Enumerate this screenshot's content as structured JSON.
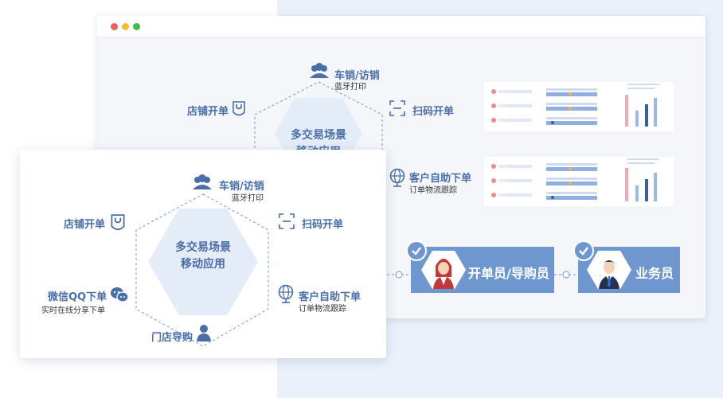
{
  "window": {
    "dot_colors": [
      "#ee5d5a",
      "#f5be2c",
      "#3dbe4f"
    ]
  },
  "back": {
    "top_node": {
      "label": "车销/访销",
      "sub": "蓝牙打印",
      "icon": "people-group-icon"
    },
    "left_node": {
      "label": "店铺开单",
      "icon": "shopping-bag-icon"
    },
    "right_node": {
      "label": "扫码开单",
      "icon": "scan-icon"
    },
    "customer_node": {
      "label": "客户自助下单",
      "sub": "订单物流跟踪",
      "icon": "globe-icon"
    },
    "center": {
      "line1": "多交易场景",
      "line2": "移动应用"
    }
  },
  "front": {
    "top_node": {
      "label": "车销/访销",
      "sub": "蓝牙打印",
      "icon": "people-group-icon"
    },
    "left_node": {
      "label": "店铺开单",
      "icon": "shopping-bag-icon"
    },
    "right_node": {
      "label": "扫码开单",
      "icon": "scan-icon"
    },
    "wechat_node": {
      "label": "微信QQ下单",
      "sub": "实时在线分享下单",
      "icon": "wechat-icon"
    },
    "customer_node": {
      "label": "客户自助下单",
      "sub": "订单物流跟踪",
      "icon": "globe-icon"
    },
    "guide_node": {
      "label": "门店导购",
      "icon": "person-icon"
    },
    "center": {
      "line1": "多交易场景",
      "line2": "移动应用"
    }
  },
  "roles": {
    "clerk": {
      "label": "开单员/导购员",
      "icon": "female-avatar-icon"
    },
    "sales": {
      "label": "业务员",
      "icon": "male-avatar-icon"
    }
  },
  "colors": {
    "accent": "#4a6ea8",
    "role_bg": "#6f97cf",
    "dashed": "#6f97cf"
  }
}
